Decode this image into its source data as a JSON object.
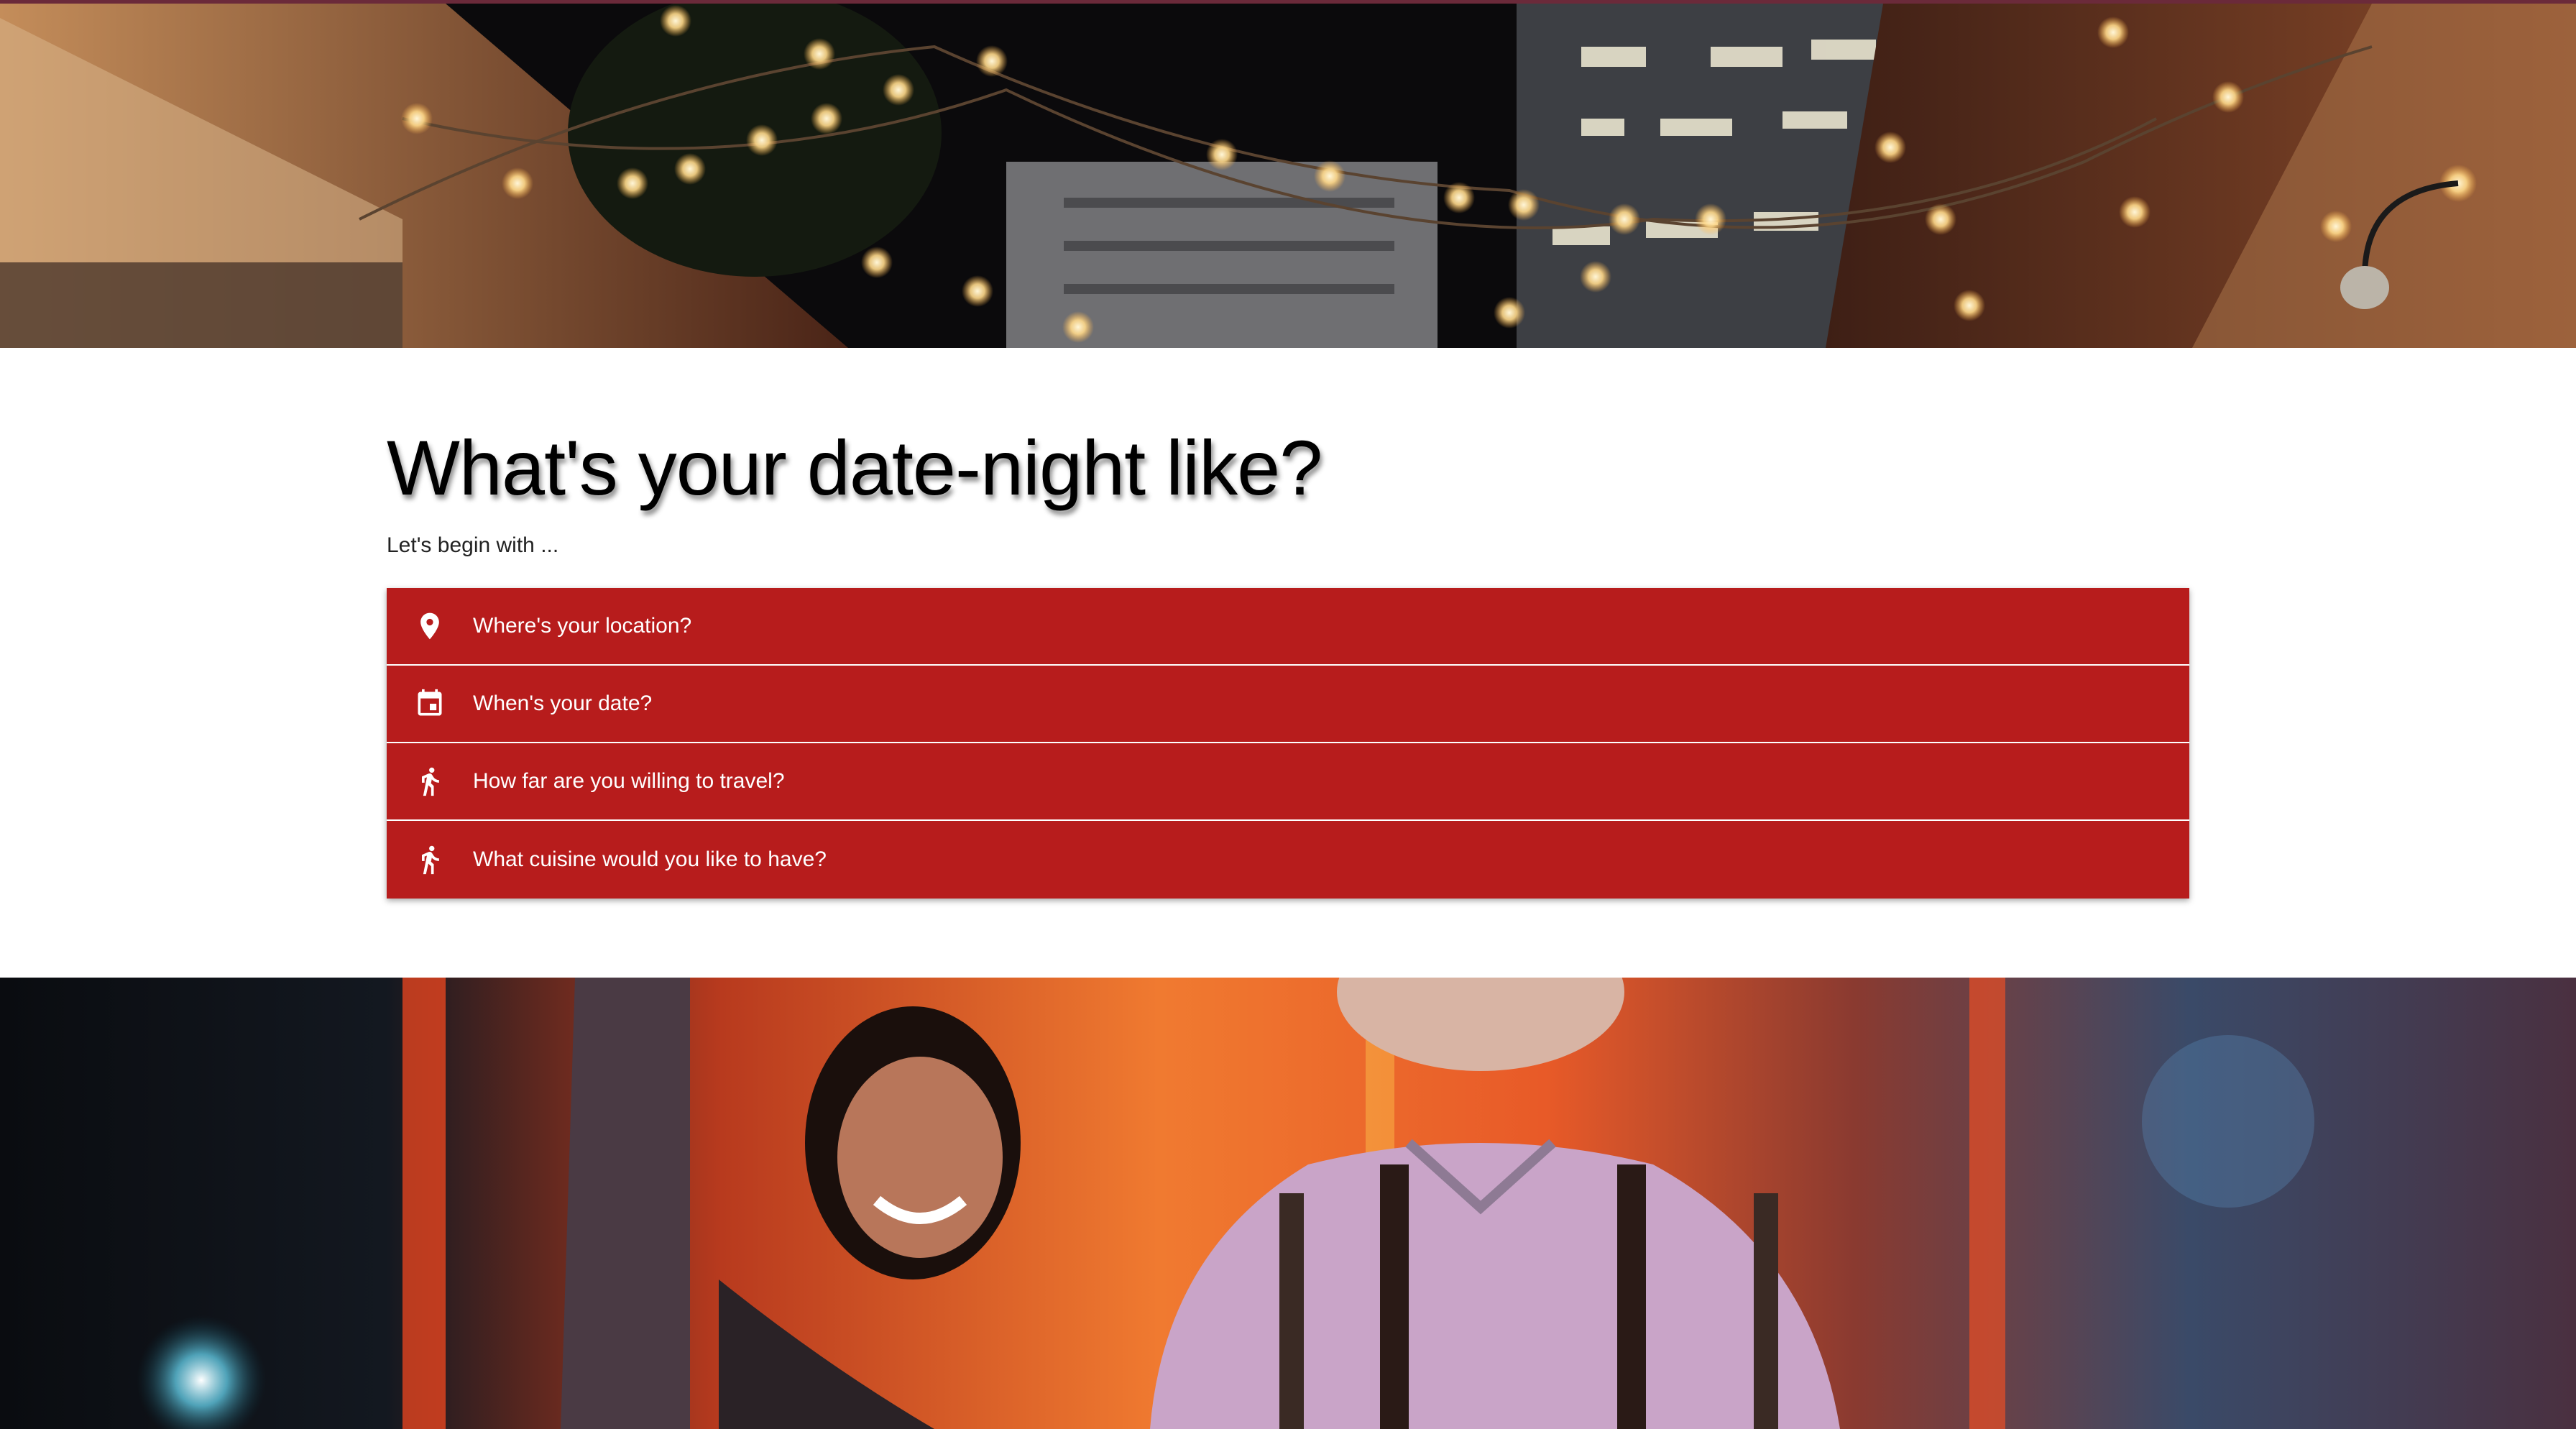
{
  "page": {
    "title": "What's your date-night like?",
    "intro": "Let's begin with ..."
  },
  "accordion": {
    "items": [
      {
        "label": "Where's your location?",
        "icon": "location-pin-icon"
      },
      {
        "label": "When's your date?",
        "icon": "calendar-icon"
      },
      {
        "label": "How far are you willing to travel?",
        "icon": "walking-person-icon"
      },
      {
        "label": "What cuisine would you like to have?",
        "icon": "walking-person-icon"
      }
    ]
  },
  "colors": {
    "accent": "#b71c1c",
    "top_border": "#6b2a3a"
  }
}
